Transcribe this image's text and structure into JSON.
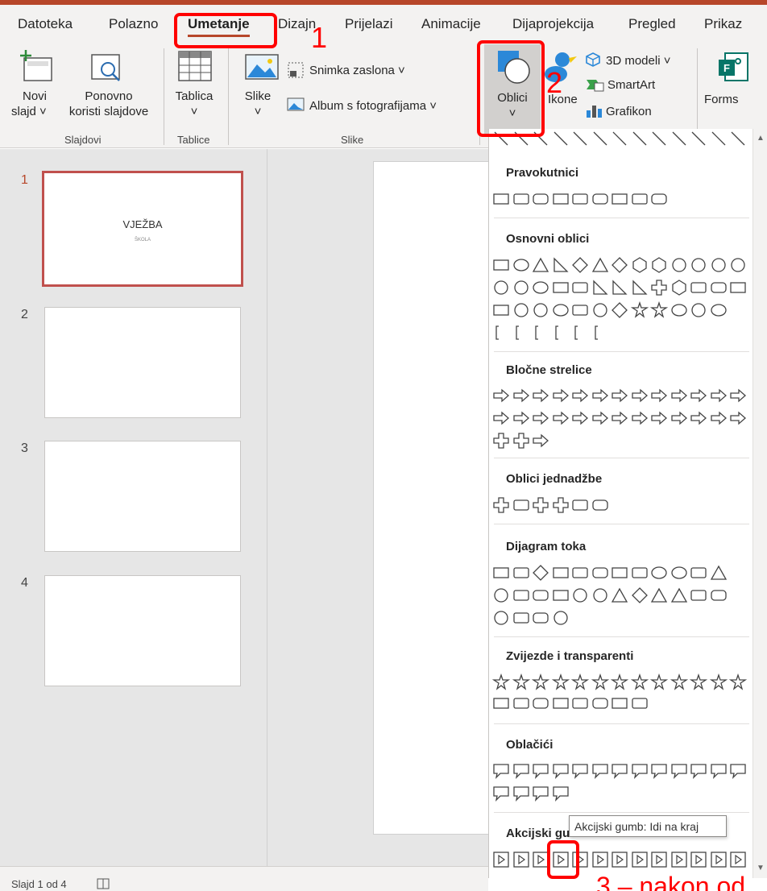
{
  "menu": {
    "tabs": [
      "Datoteka",
      "Polazno",
      "Umetanje",
      "Dizajn",
      "Prijelazi",
      "Animacije",
      "Dijaprojekcija",
      "Pregled",
      "Prikaz"
    ],
    "active_tab": "Umetanje"
  },
  "ribbon": {
    "new_slide": [
      "Novi",
      "slajd ˅"
    ],
    "reuse_slides": [
      "Ponovno",
      "koristi slajdove"
    ],
    "table": [
      "Tablica",
      "˅"
    ],
    "pictures": [
      "Slike",
      "˅"
    ],
    "screenshot": "Snimka zaslona ˅",
    "photo_album": "Album s fotografijama ˅",
    "shapes": [
      "Oblici",
      "˅"
    ],
    "icons": "Ikone",
    "models_3d": "3D modeli ˅",
    "smartart": "SmartArt",
    "chart": "Grafikon",
    "forms": "Forms",
    "groups": [
      "Slajdovi",
      "Tablice",
      "Slike"
    ]
  },
  "slides": {
    "numbers": [
      "1",
      "2",
      "3",
      "4"
    ],
    "first_title": "VJEŽBA",
    "first_subtitle": "ŠKOLA"
  },
  "status": {
    "text": "Slajd 1 od 4"
  },
  "shapes_panel": {
    "sections": [
      "Pravokutnici",
      "Osnovni oblici",
      "Bločne strelice",
      "Oblici jednadžbe",
      "Dijagram toka",
      "Zvijezde i transparenti",
      "Oblačići",
      "Akcijski gumbi"
    ],
    "tooltip": "Akcijski gumb: Idi na kraj"
  },
  "annotations": {
    "num1": "1",
    "num2": "2",
    "step3": "3 – nakon od"
  },
  "colors": {
    "accent": "#b7472a",
    "annotation": "#ff0000"
  }
}
